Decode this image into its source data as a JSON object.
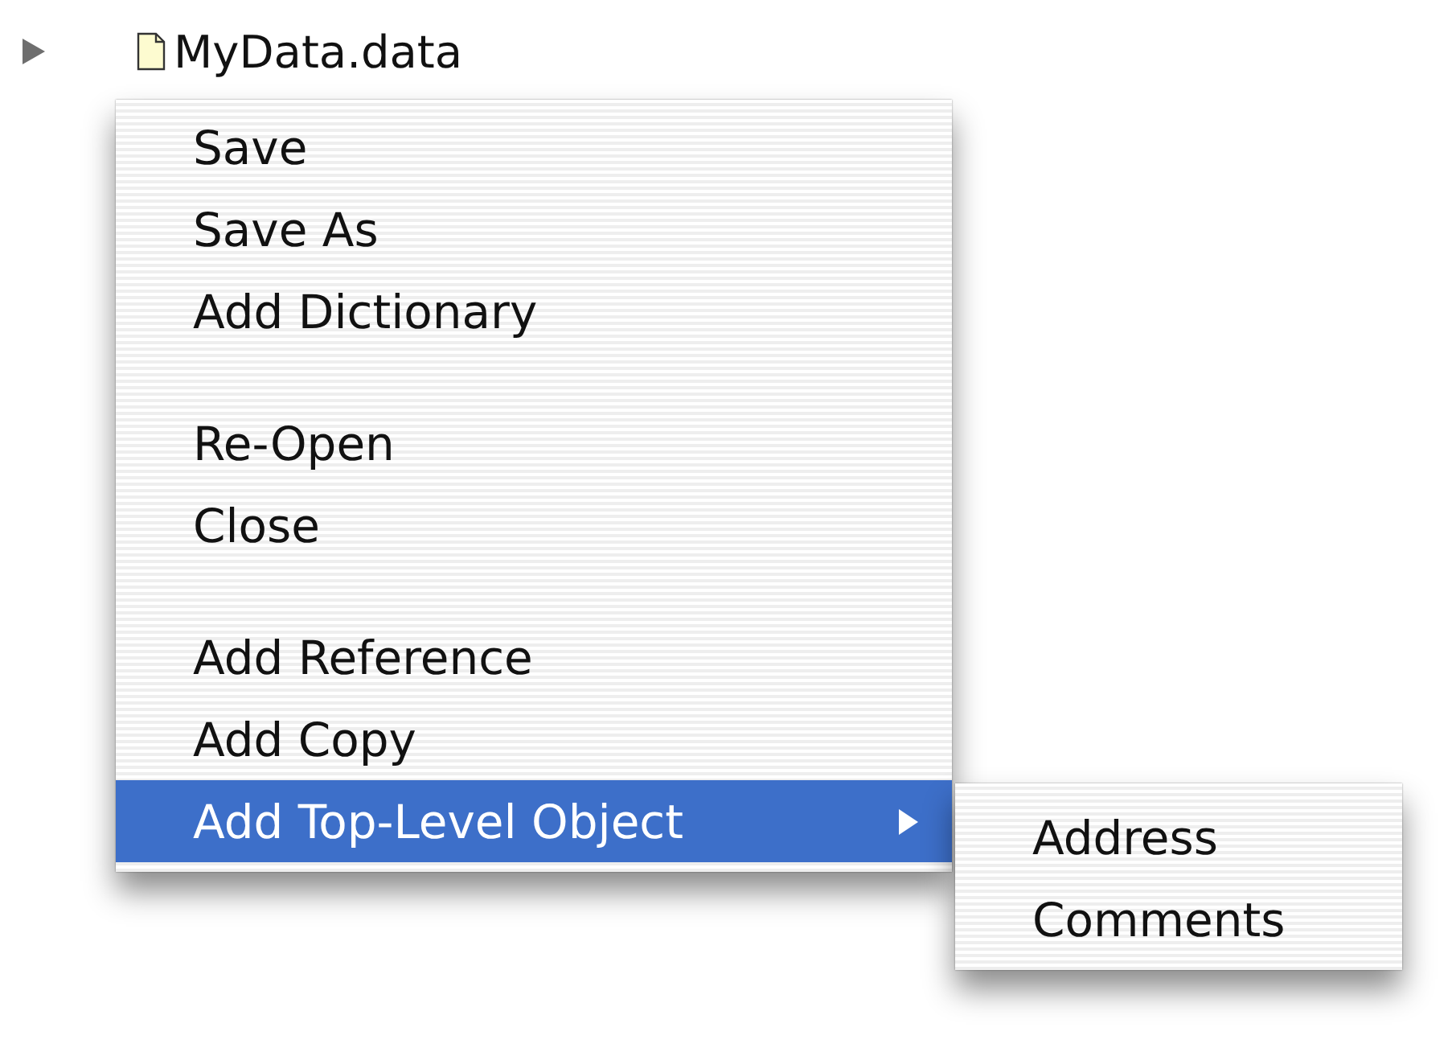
{
  "file": {
    "name": "MyData.data",
    "expanded": false
  },
  "menu": {
    "items": [
      {
        "kind": "item",
        "label": "Save",
        "selected": false
      },
      {
        "kind": "item",
        "label": "Save As",
        "selected": false
      },
      {
        "kind": "item",
        "label": "Add Dictionary",
        "selected": false
      },
      {
        "kind": "separator"
      },
      {
        "kind": "item",
        "label": "Re-Open",
        "selected": false
      },
      {
        "kind": "item",
        "label": "Close",
        "selected": false
      },
      {
        "kind": "separator"
      },
      {
        "kind": "item",
        "label": "Add Reference",
        "selected": false
      },
      {
        "kind": "item",
        "label": "Add Copy",
        "selected": false
      },
      {
        "kind": "submenu",
        "label": "Add Top-Level Object",
        "selected": true
      }
    ]
  },
  "submenu": {
    "items": [
      {
        "label": "Address",
        "selected": false
      },
      {
        "label": "Comments",
        "selected": false
      }
    ]
  }
}
